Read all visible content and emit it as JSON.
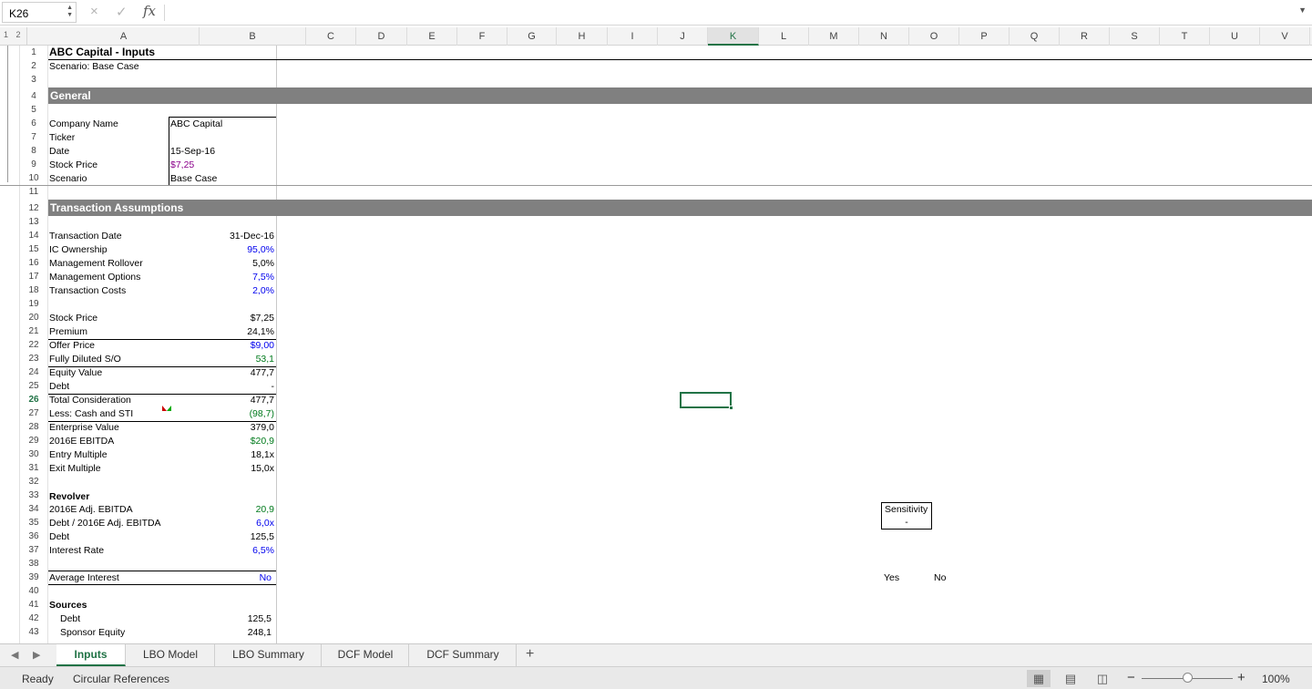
{
  "formula_bar": {
    "name_box": "K26",
    "cancel_icon": "×",
    "enter_icon": "✓",
    "fx": "fx",
    "formula": ""
  },
  "outline_levels": "1 2",
  "columns": [
    "A",
    "B",
    "C",
    "D",
    "E",
    "F",
    "G",
    "H",
    "I",
    "J",
    "K",
    "L",
    "M",
    "N",
    "O",
    "P",
    "Q",
    "R",
    "S",
    "T",
    "U",
    "V",
    "W"
  ],
  "selected_column": "K",
  "selected_row": "26",
  "rows": [
    "1",
    "2",
    "3",
    "4",
    "5",
    "6",
    "7",
    "8",
    "9",
    "10",
    "11",
    "12",
    "13",
    "14",
    "15",
    "16",
    "17",
    "18",
    "19",
    "20",
    "21",
    "22",
    "23",
    "24",
    "25",
    "26",
    "27",
    "28",
    "29",
    "30",
    "31",
    "32",
    "33",
    "34",
    "35",
    "36",
    "37",
    "38",
    "39",
    "40",
    "41",
    "42",
    "43"
  ],
  "sheet": {
    "title": "ABC Capital - Inputs",
    "scenario_line": "Scenario: Base Case",
    "general": {
      "header": "General",
      "company_name_label": "Company Name",
      "company_name": "ABC Capital",
      "ticker_label": "Ticker",
      "ticker": "",
      "date_label": "Date",
      "date": "15-Sep-16",
      "stock_price_label": "Stock Price",
      "stock_price": "$7,25",
      "scenario_label": "Scenario",
      "scenario": "Base Case"
    },
    "transaction": {
      "header": "Transaction Assumptions",
      "items": [
        {
          "label": "Transaction Date",
          "value": "31-Dec-16",
          "color": "black"
        },
        {
          "label": "IC Ownership",
          "value": "95,0%",
          "color": "blue"
        },
        {
          "label": "Management Rollover",
          "value": "5,0%",
          "color": "black"
        },
        {
          "label": "Management Options",
          "value": "7,5%",
          "color": "blue"
        },
        {
          "label": "Transaction Costs",
          "value": "2,0%",
          "color": "blue"
        }
      ],
      "valuation": [
        {
          "label": "Stock Price",
          "value": "$7,25",
          "color": "black"
        },
        {
          "label": "Premium",
          "value": "24,1%",
          "color": "black"
        },
        {
          "label": "Offer Price",
          "value": "$9,00",
          "color": "blue"
        },
        {
          "label": "Fully Diluted S/O",
          "value": "53,1",
          "color": "green"
        },
        {
          "label": "Equity Value",
          "value": "477,7",
          "color": "black"
        },
        {
          "label": "Debt",
          "value": "-",
          "color": "black"
        },
        {
          "label": "Total Consideration",
          "value": "477,7",
          "color": "black"
        },
        {
          "label": "Less: Cash and STI",
          "value": "(98,7)",
          "color": "green"
        },
        {
          "label": "Enterprise Value",
          "value": "379,0",
          "color": "black"
        },
        {
          "label": "2016E EBITDA",
          "value": "$20,9",
          "color": "green"
        },
        {
          "label": "Entry Multiple",
          "value": "18,1x",
          "color": "black"
        },
        {
          "label": "Exit Multiple",
          "value": "15,0x",
          "color": "black"
        }
      ]
    },
    "revolver": {
      "header": "Revolver",
      "items": [
        {
          "label": "2016E Adj. EBITDA",
          "value": "20,9",
          "color": "green"
        },
        {
          "label": "Debt / 2016E Adj. EBITDA",
          "value": "6,0x",
          "color": "blue"
        },
        {
          "label": "Debt",
          "value": "125,5",
          "color": "black"
        },
        {
          "label": "Interest Rate",
          "value": "6,5%",
          "color": "blue"
        }
      ],
      "average_interest_label": "Average Interest",
      "average_interest": "No"
    },
    "sources": {
      "header": "Sources",
      "items": [
        {
          "label": "Debt",
          "value": "125,5"
        },
        {
          "label": "Sponsor Equity",
          "value": "248,1"
        }
      ]
    },
    "sensitivity": {
      "label": "Sensitivity",
      "value": "-",
      "yes": "Yes",
      "no": "No"
    }
  },
  "tabs": [
    "Inputs",
    "LBO Model",
    "LBO Summary",
    "DCF Model",
    "DCF Summary"
  ],
  "active_tab": "Inputs",
  "status": {
    "ready": "Ready",
    "circular": "Circular References",
    "zoom": "100%"
  },
  "colors": {
    "accent": "#217346",
    "band": "#808080",
    "input_blue": "#0000ee",
    "link_green": "#007a1c",
    "purple": "#8b008b"
  }
}
